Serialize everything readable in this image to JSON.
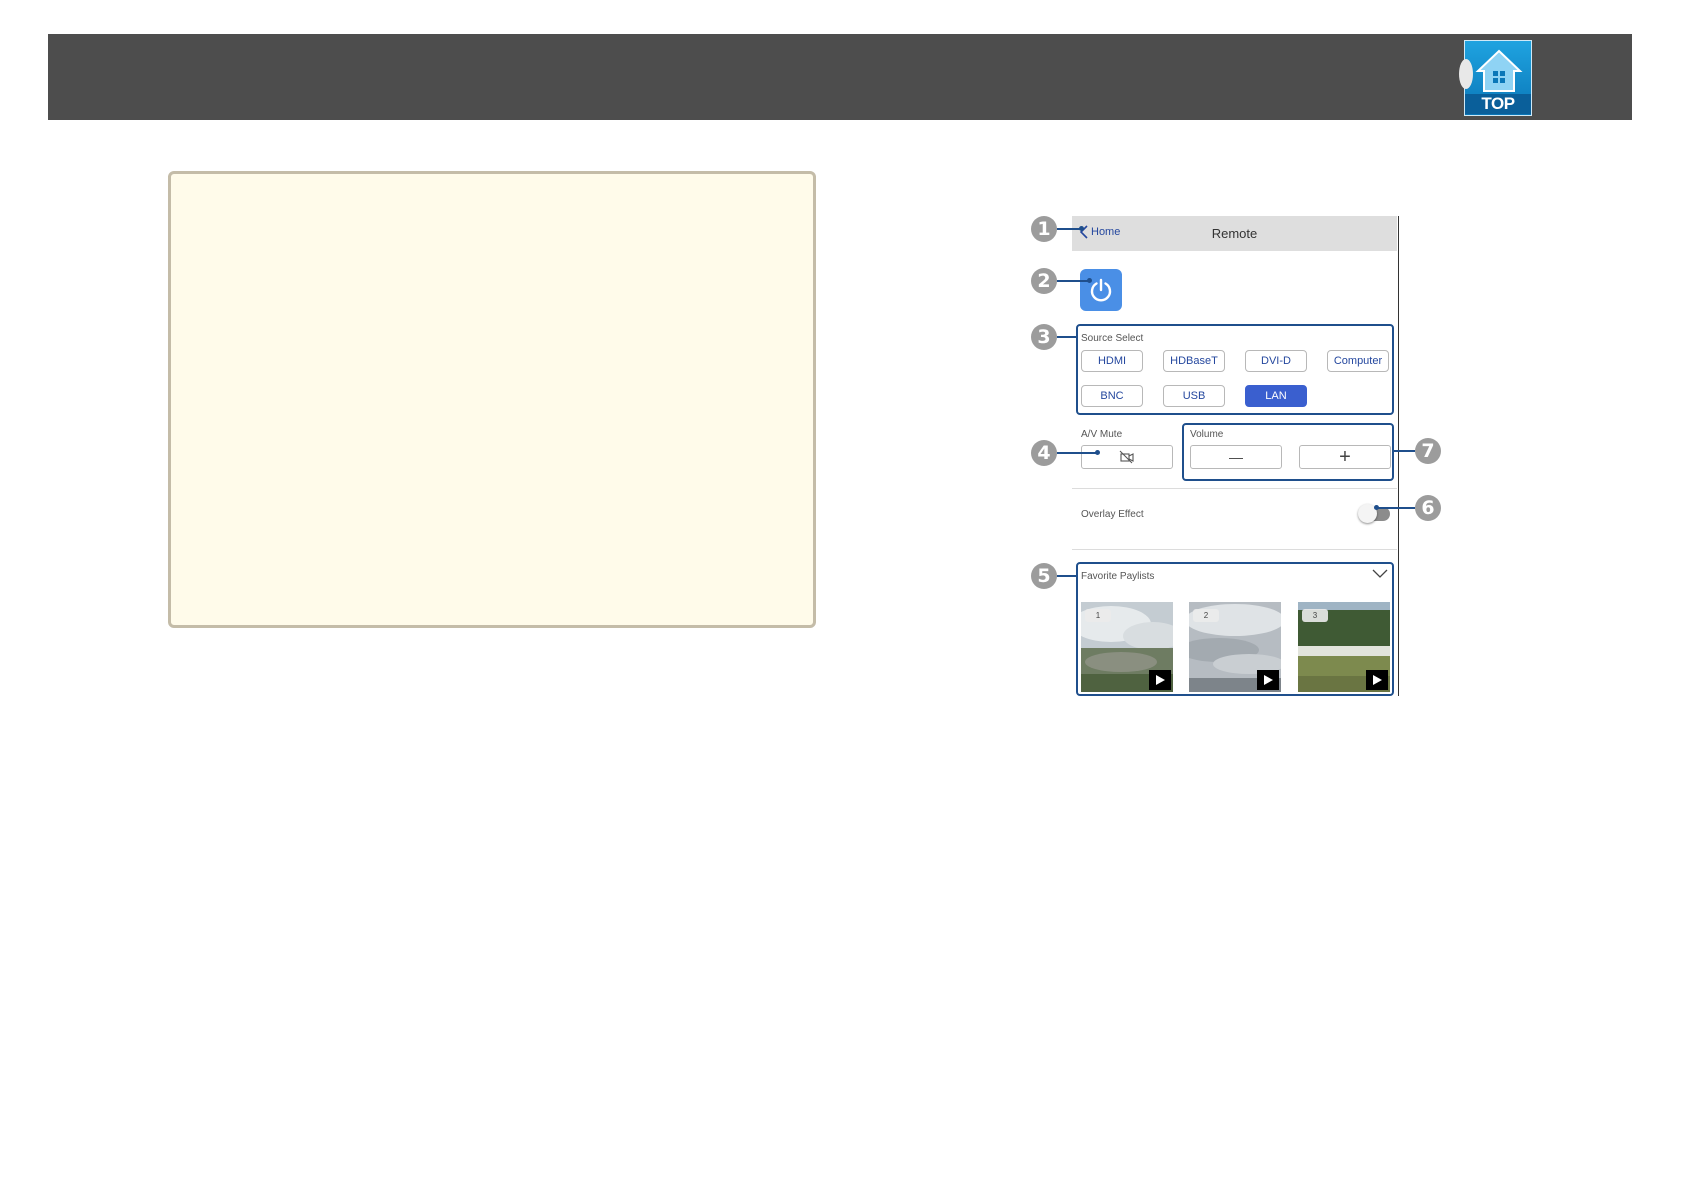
{
  "header": {
    "logo_text": "TOP"
  },
  "remote": {
    "back_label": "Home",
    "title": "Remote",
    "source_select": {
      "label": "Source Select",
      "buttons": [
        "HDMI",
        "HDBaseT",
        "DVI-D",
        "Computer",
        "BNC",
        "USB",
        "LAN"
      ],
      "selected": "LAN"
    },
    "av_mute": {
      "label": "A/V Mute"
    },
    "volume": {
      "label": "Volume",
      "decrease_symbol": "—",
      "increase_symbol": "+"
    },
    "overlay_effect": {
      "label": "Overlay Effect",
      "enabled": false
    },
    "favorite_playlists": {
      "label": "Favorite Paylists",
      "items": [
        {
          "number": "1"
        },
        {
          "number": "2"
        },
        {
          "number": "3"
        }
      ]
    }
  },
  "callouts": [
    "1",
    "2",
    "3",
    "4",
    "5",
    "6",
    "7"
  ],
  "colors": {
    "header_bar": "#4d4d4d",
    "note_background": "#fffbea",
    "accent_blue": "#3a5fcf",
    "power_blue": "#4a8fe6",
    "callout_line": "#1f4f8c",
    "callout_badge": "#9c9c9c"
  },
  "icons": {
    "logo": "home-icon",
    "back": "chevron-left-icon",
    "power": "power-icon",
    "mute": "muted-camera-icon",
    "expand": "chevron-down-icon",
    "play": "play-icon"
  }
}
